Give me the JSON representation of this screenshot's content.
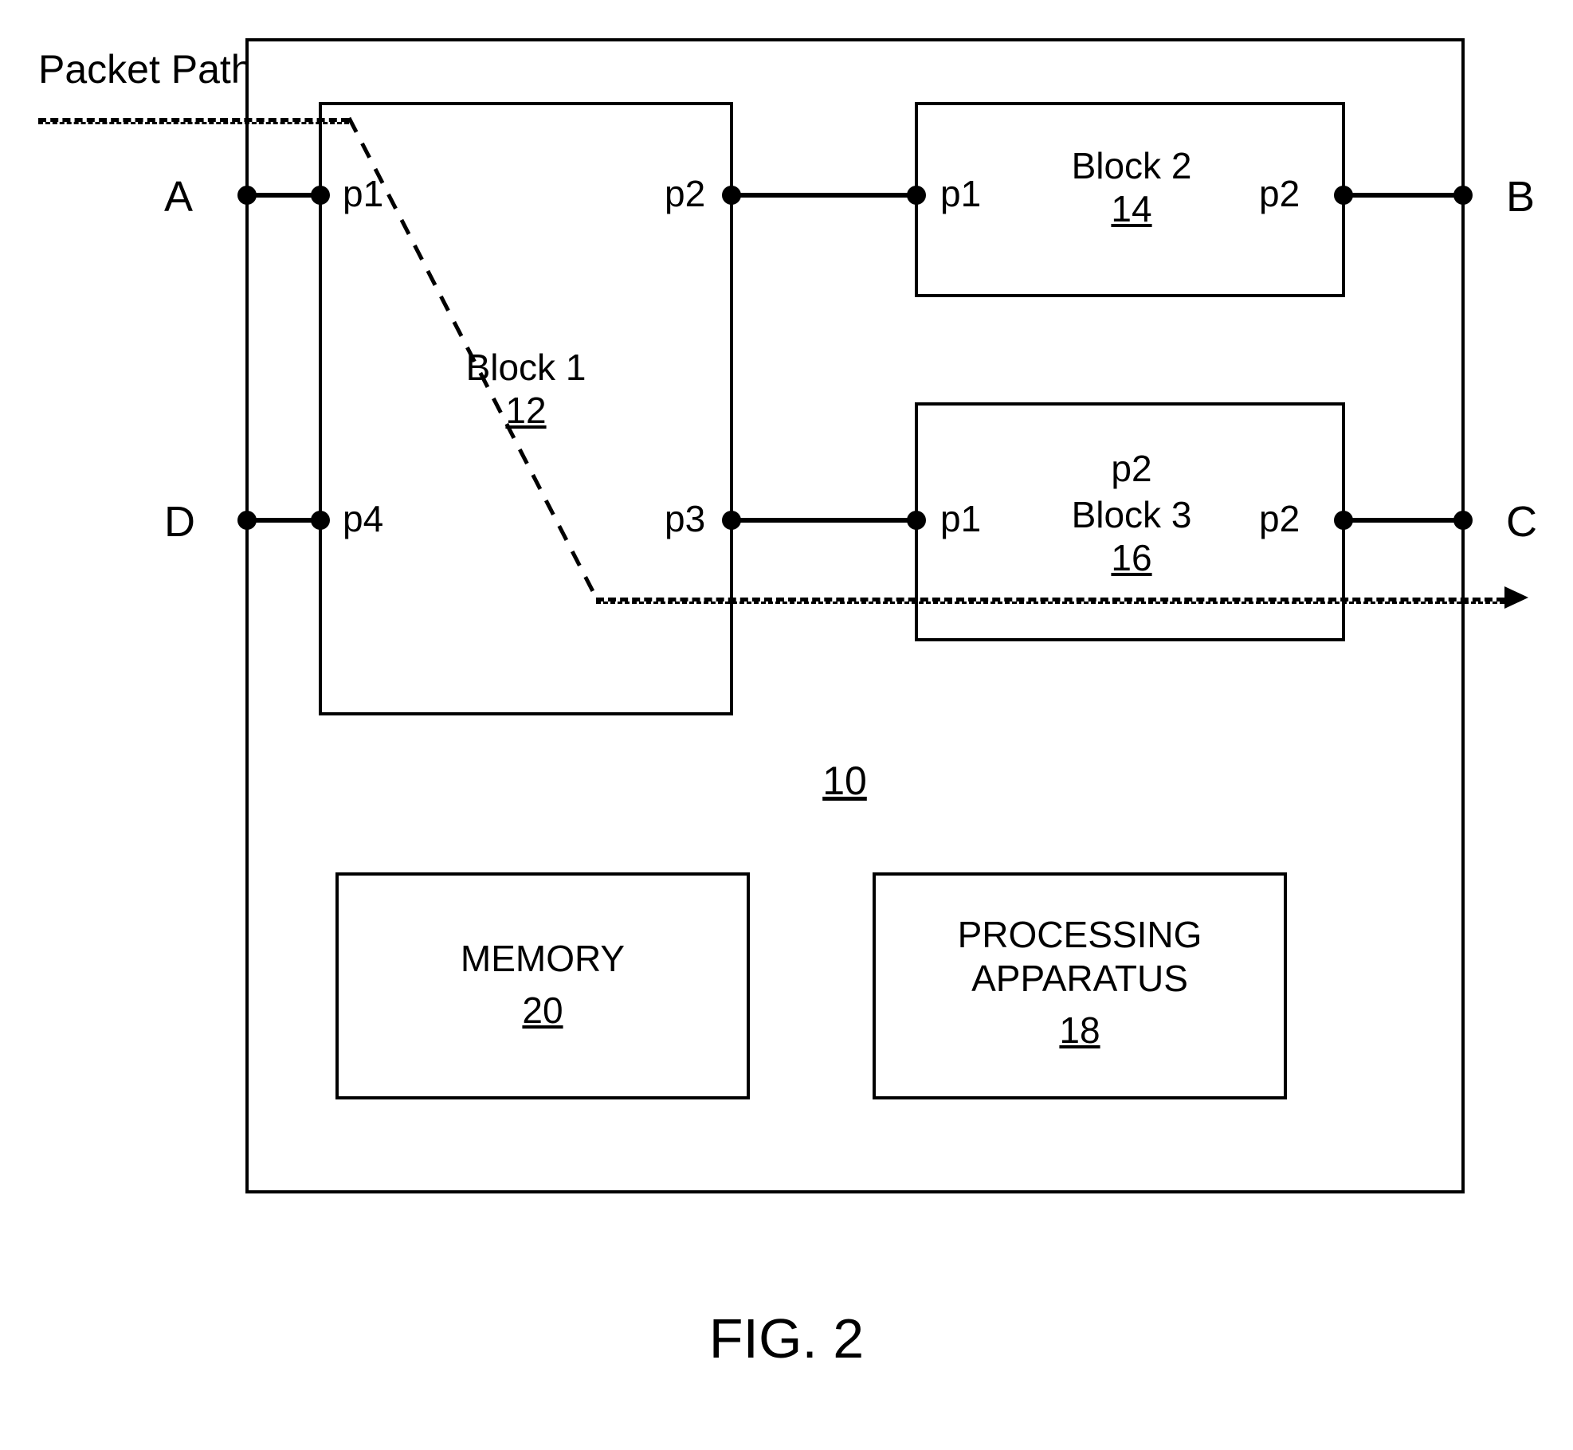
{
  "figure_caption": "FIG. 2",
  "packet_path_label": "Packet Path",
  "outer_ref": "10",
  "terminals": {
    "A": "A",
    "B": "B",
    "C": "C",
    "D": "D"
  },
  "block1": {
    "title": "Block 1",
    "ref": "12",
    "ports": {
      "p1": "p1",
      "p2": "p2",
      "p3": "p3",
      "p4": "p4"
    }
  },
  "block2": {
    "title": "Block 2",
    "ref": "14",
    "ports": {
      "p1": "p1",
      "p2": "p2"
    }
  },
  "block3": {
    "title": "Block 3",
    "ref": "16",
    "p2_upper": "p2",
    "ports": {
      "p1": "p1",
      "p2": "p2"
    }
  },
  "memory": {
    "title": "MEMORY",
    "ref": "20"
  },
  "processing": {
    "title_line1": "PROCESSING",
    "title_line2": "APPARATUS",
    "ref": "18"
  }
}
